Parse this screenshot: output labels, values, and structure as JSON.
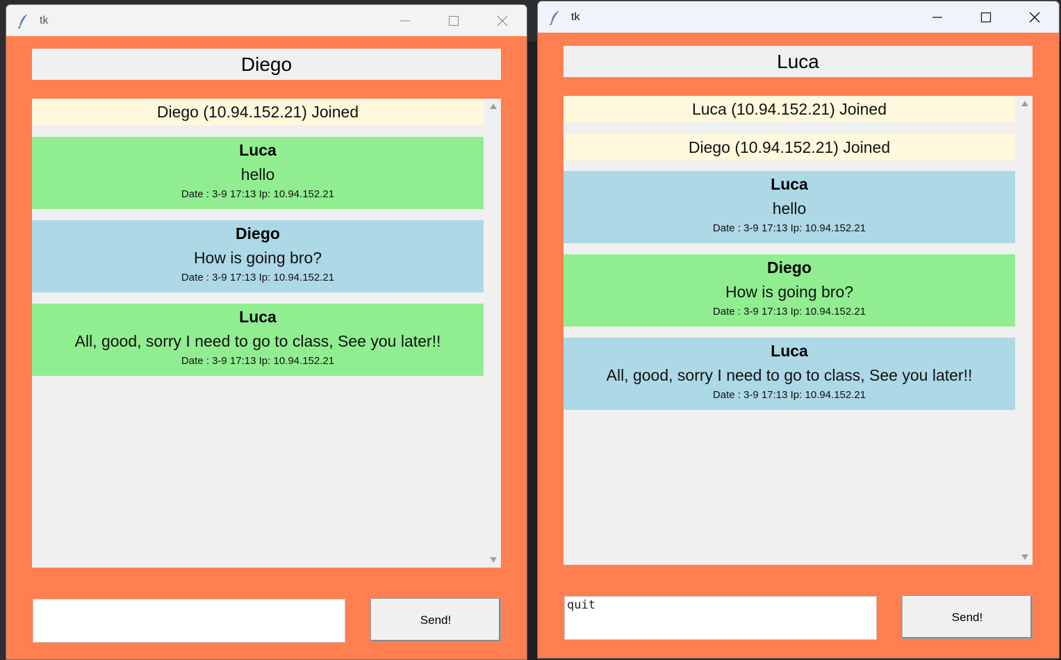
{
  "left_window": {
    "title": "tk",
    "username": "Diego",
    "messages": [
      {
        "kind": "join",
        "text": "Diego (10.94.152.21) Joined"
      },
      {
        "kind": "green",
        "name": "Luca",
        "text": "hello",
        "date": "Date : 3-9 17:13 Ip: 10.94.152.21"
      },
      {
        "kind": "blue",
        "name": "Diego",
        "text": "How is going bro?",
        "date": "Date : 3-9 17:13 Ip: 10.94.152.21"
      },
      {
        "kind": "green",
        "name": "Luca",
        "text": "All, good, sorry I need to go to class, See you later!!",
        "date": "Date : 3-9 17:13 Ip: 10.94.152.21"
      }
    ],
    "entry_value": "",
    "send_label": "Send!"
  },
  "right_window": {
    "title": "tk",
    "username": "Luca",
    "messages": [
      {
        "kind": "join",
        "text": "Luca (10.94.152.21) Joined"
      },
      {
        "kind": "join",
        "text": "Diego (10.94.152.21) Joined"
      },
      {
        "kind": "blue",
        "name": "Luca",
        "text": "hello",
        "date": "Date : 3-9 17:13 Ip: 10.94.152.21"
      },
      {
        "kind": "green",
        "name": "Diego",
        "text": "How is going bro?",
        "date": "Date : 3-9 17:13 Ip: 10.94.152.21"
      },
      {
        "kind": "blue",
        "name": "Luca",
        "text": "All, good, sorry I need to go to class, See you later!!",
        "date": "Date : 3-9 17:13 Ip: 10.94.152.21"
      }
    ],
    "entry_value": "quit",
    "send_label": "Send!"
  },
  "colors": {
    "window_bg": "#ff7f50",
    "join_bg": "#fff8dc",
    "green_bubble": "#90ee90",
    "blue_bubble": "#add8e6",
    "panel_bg": "#f0f0f0"
  }
}
